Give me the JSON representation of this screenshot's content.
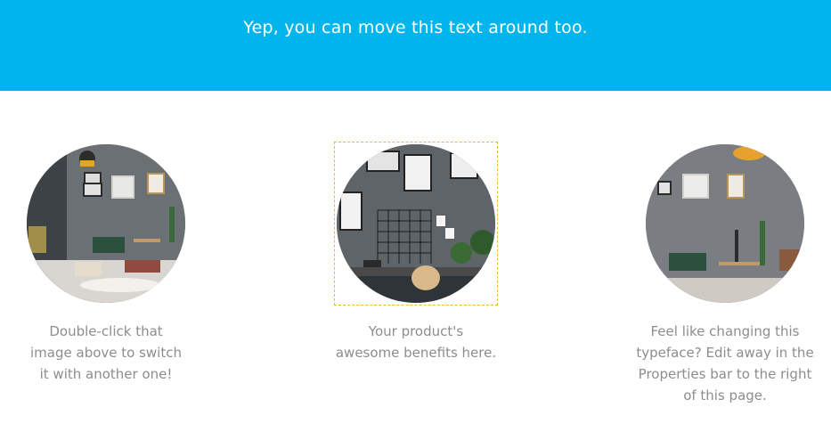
{
  "banner": {
    "text": "Yep, you can move this text around too."
  },
  "cards": [
    {
      "image": "living-room-image",
      "caption_lines": [
        "Double-click that",
        "image above to switch",
        "it with another one!"
      ]
    },
    {
      "image": "workspace-image",
      "selected": true,
      "caption_lines": [
        "Your product's",
        "awesome benefits here."
      ]
    },
    {
      "image": "lounge-image",
      "caption_lines": [
        "Feel like changing this",
        "typeface? Edit away in the",
        "Properties bar to the right",
        "of this page."
      ]
    }
  ],
  "colors": {
    "banner": "#00b5ec",
    "caption": "#8d8d8d",
    "selection": "#f0b53a"
  }
}
